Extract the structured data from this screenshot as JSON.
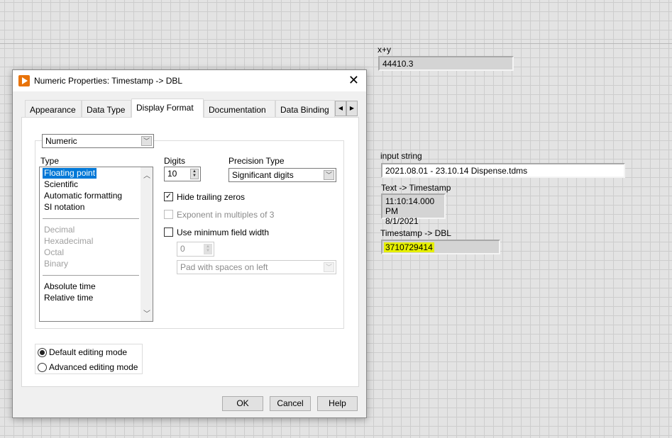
{
  "front_panel": {
    "xy": {
      "label": "x+y",
      "value": "44410.3"
    },
    "input_string": {
      "label": "input string",
      "value": "2021.08.01 - 23.10.14 Dispense.tdms"
    },
    "text_timestamp": {
      "label": "Text -> Timestamp",
      "time": "11:10:14.000 PM",
      "date": "8/1/2021"
    },
    "timestamp_dbl": {
      "label": "Timestamp -> DBL",
      "value": "3710729414",
      "highlight_color": "#e6ef00"
    }
  },
  "dialog": {
    "title": "Numeric Properties: Timestamp -> DBL",
    "tabs": [
      "Appearance",
      "Data Type",
      "Display Format",
      "Documentation",
      "Data Binding"
    ],
    "active_tab": "Display Format",
    "category": "Numeric",
    "type_label": "Type",
    "types": {
      "group1": [
        "Floating point",
        "Scientific",
        "Automatic formatting",
        "SI notation"
      ],
      "group2": [
        "Decimal",
        "Hexadecimal",
        "Octal",
        "Binary"
      ],
      "group3": [
        "Absolute time",
        "Relative time"
      ]
    },
    "selected_type": "Floating point",
    "digits_label": "Digits",
    "digits": "10",
    "precision_label": "Precision Type",
    "precision": "Significant digits",
    "hide_trailing_zeros": {
      "label": "Hide trailing zeros",
      "checked": true
    },
    "exponent_multiples": {
      "label": "Exponent in multiples of 3",
      "checked": false,
      "enabled": false
    },
    "use_min_width": {
      "label": "Use minimum field width",
      "checked": false
    },
    "min_width": "0",
    "padding": "Pad with spaces on left",
    "modes": [
      "Default editing mode",
      "Advanced editing mode"
    ],
    "selected_mode": "Default editing mode",
    "buttons": {
      "ok": "OK",
      "cancel": "Cancel",
      "help": "Help"
    },
    "accent_color": "#0078d7"
  }
}
